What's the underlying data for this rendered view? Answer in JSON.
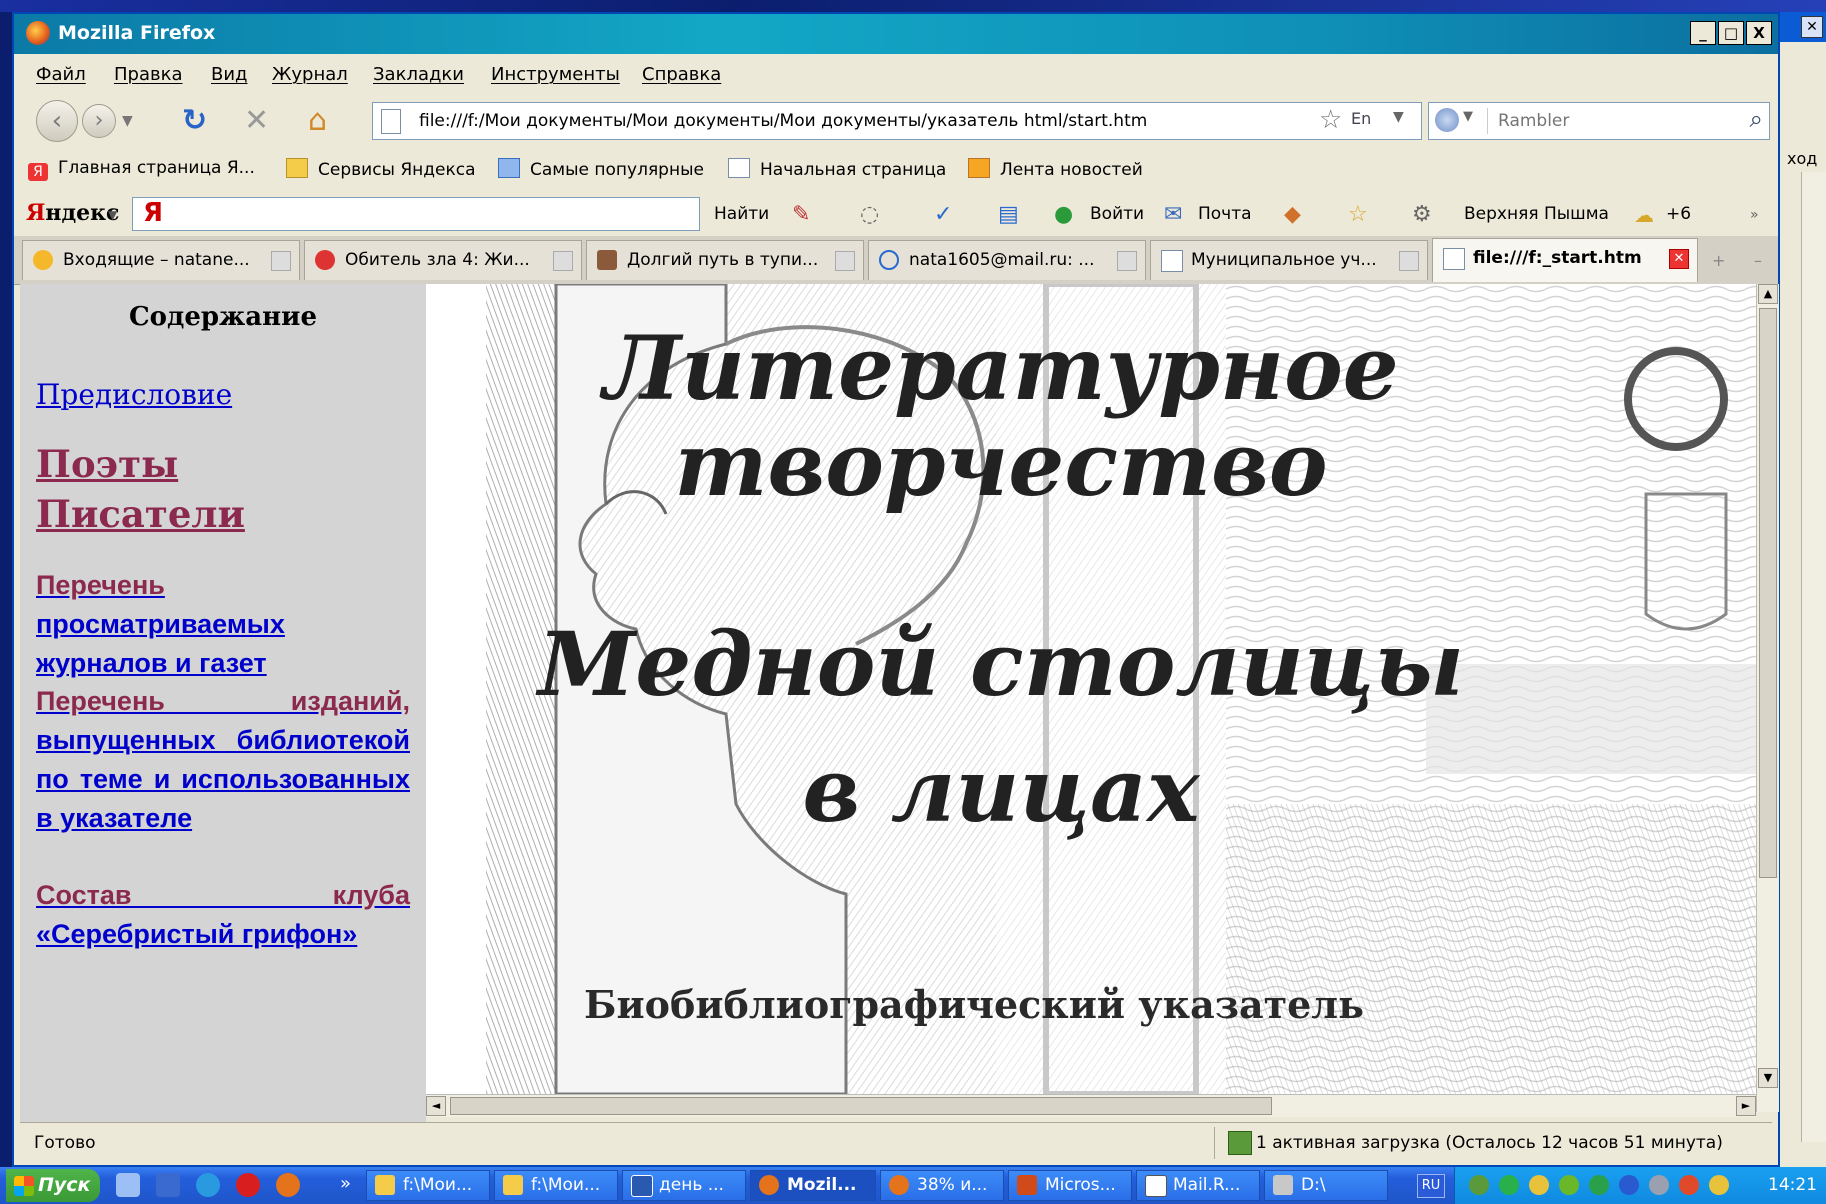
{
  "window": {
    "title": "Mozilla Firefox",
    "buttons": [
      "_",
      "□",
      "X"
    ]
  },
  "menu": [
    "Файл",
    "Правка",
    "Вид",
    "Журнал",
    "Закладки",
    "Инструменты",
    "Справка"
  ],
  "nav": {
    "url": "file:///f:/Мои документы/Мои документы/Мои документы/указатель html/start.htm",
    "search_placeholder": "Rambler"
  },
  "bookmarks": [
    "Главная страница Я...",
    "Сервисы Яндекса",
    "Самые популярные",
    "Начальная страница",
    "Лента новостей"
  ],
  "yandex_bar": {
    "logo_a": "Я",
    "logo_b": "ндекс",
    "find": "Найти",
    "login": "Войти",
    "mail": "Почта",
    "weather": "Верхняя Пышма",
    "temp": "+6"
  },
  "tabs": [
    "Входящие – natane...",
    "Обитель зла 4: Жи...",
    "Долгий путь в тупи...",
    "nata1605@mail.ru: ...",
    "Муниципальное уч...",
    "file:///f:_start.htm"
  ],
  "sidebar": {
    "heading": "Содержание",
    "preface": "Предисловие",
    "poets": "Поэты",
    "writers": "Писатели",
    "list1_a": "Перечень",
    "list1_b": "просматриваемых журналов и газет",
    "list2_a": "Перечень изданий,",
    "list2_b": "выпущенных библиотекой по теме и использованных в указателе",
    "club_a": "Состав клуба",
    "club_b": "«Серебристый грифон»"
  },
  "main": {
    "line1": "Литературное",
    "line2": "творчество",
    "line3": "Медной столицы",
    "line4": "в лицах",
    "subtitle": "Биобиблиографический указатель"
  },
  "status": {
    "left": "Готово",
    "right": "1 активная загрузка (Осталось 12 часов 51 минута)"
  },
  "taskbar": {
    "start": "Пуск",
    "items": [
      "f:\\Мои...",
      "f:\\Мои...",
      "день ...",
      "Mozil...",
      "38% и...",
      "Micros...",
      "Mail.R...",
      "D:\\"
    ],
    "lang": "RU",
    "clock": "14:21"
  },
  "bg_window": {
    "label": "ход"
  }
}
